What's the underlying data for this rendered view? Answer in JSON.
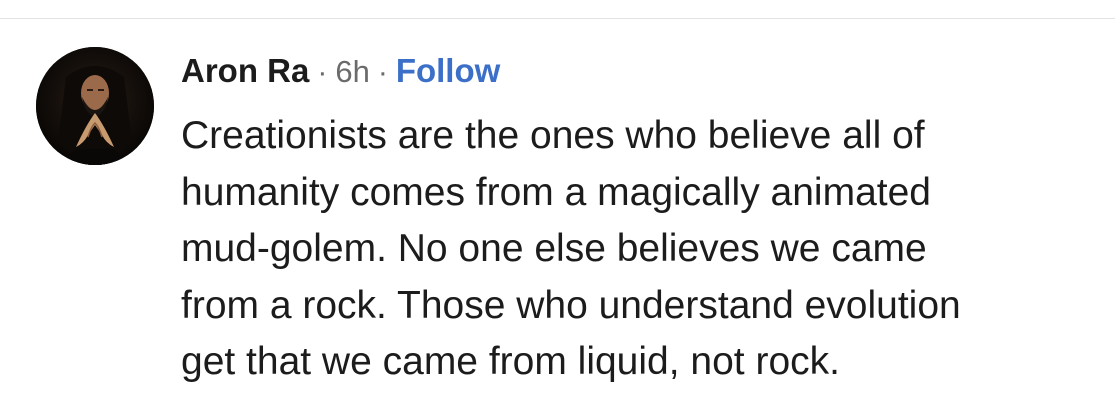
{
  "comment": {
    "author": "Aron Ra",
    "separator": "·",
    "timestamp": "6h",
    "follow_label": "Follow",
    "body_lines": [
      "Creationists are the ones who believe all of",
      "humanity comes from a magically animated",
      "mud-golem. No one else believes we came",
      "from a rock. Those who understand evolution",
      "get that we came from liquid, not rock."
    ]
  },
  "colors": {
    "follow_link": "#3b6fc8",
    "meta_text": "#6b6b6b",
    "body_text": "#1c1c1c"
  },
  "icons": {
    "avatar": "profile-photo"
  }
}
